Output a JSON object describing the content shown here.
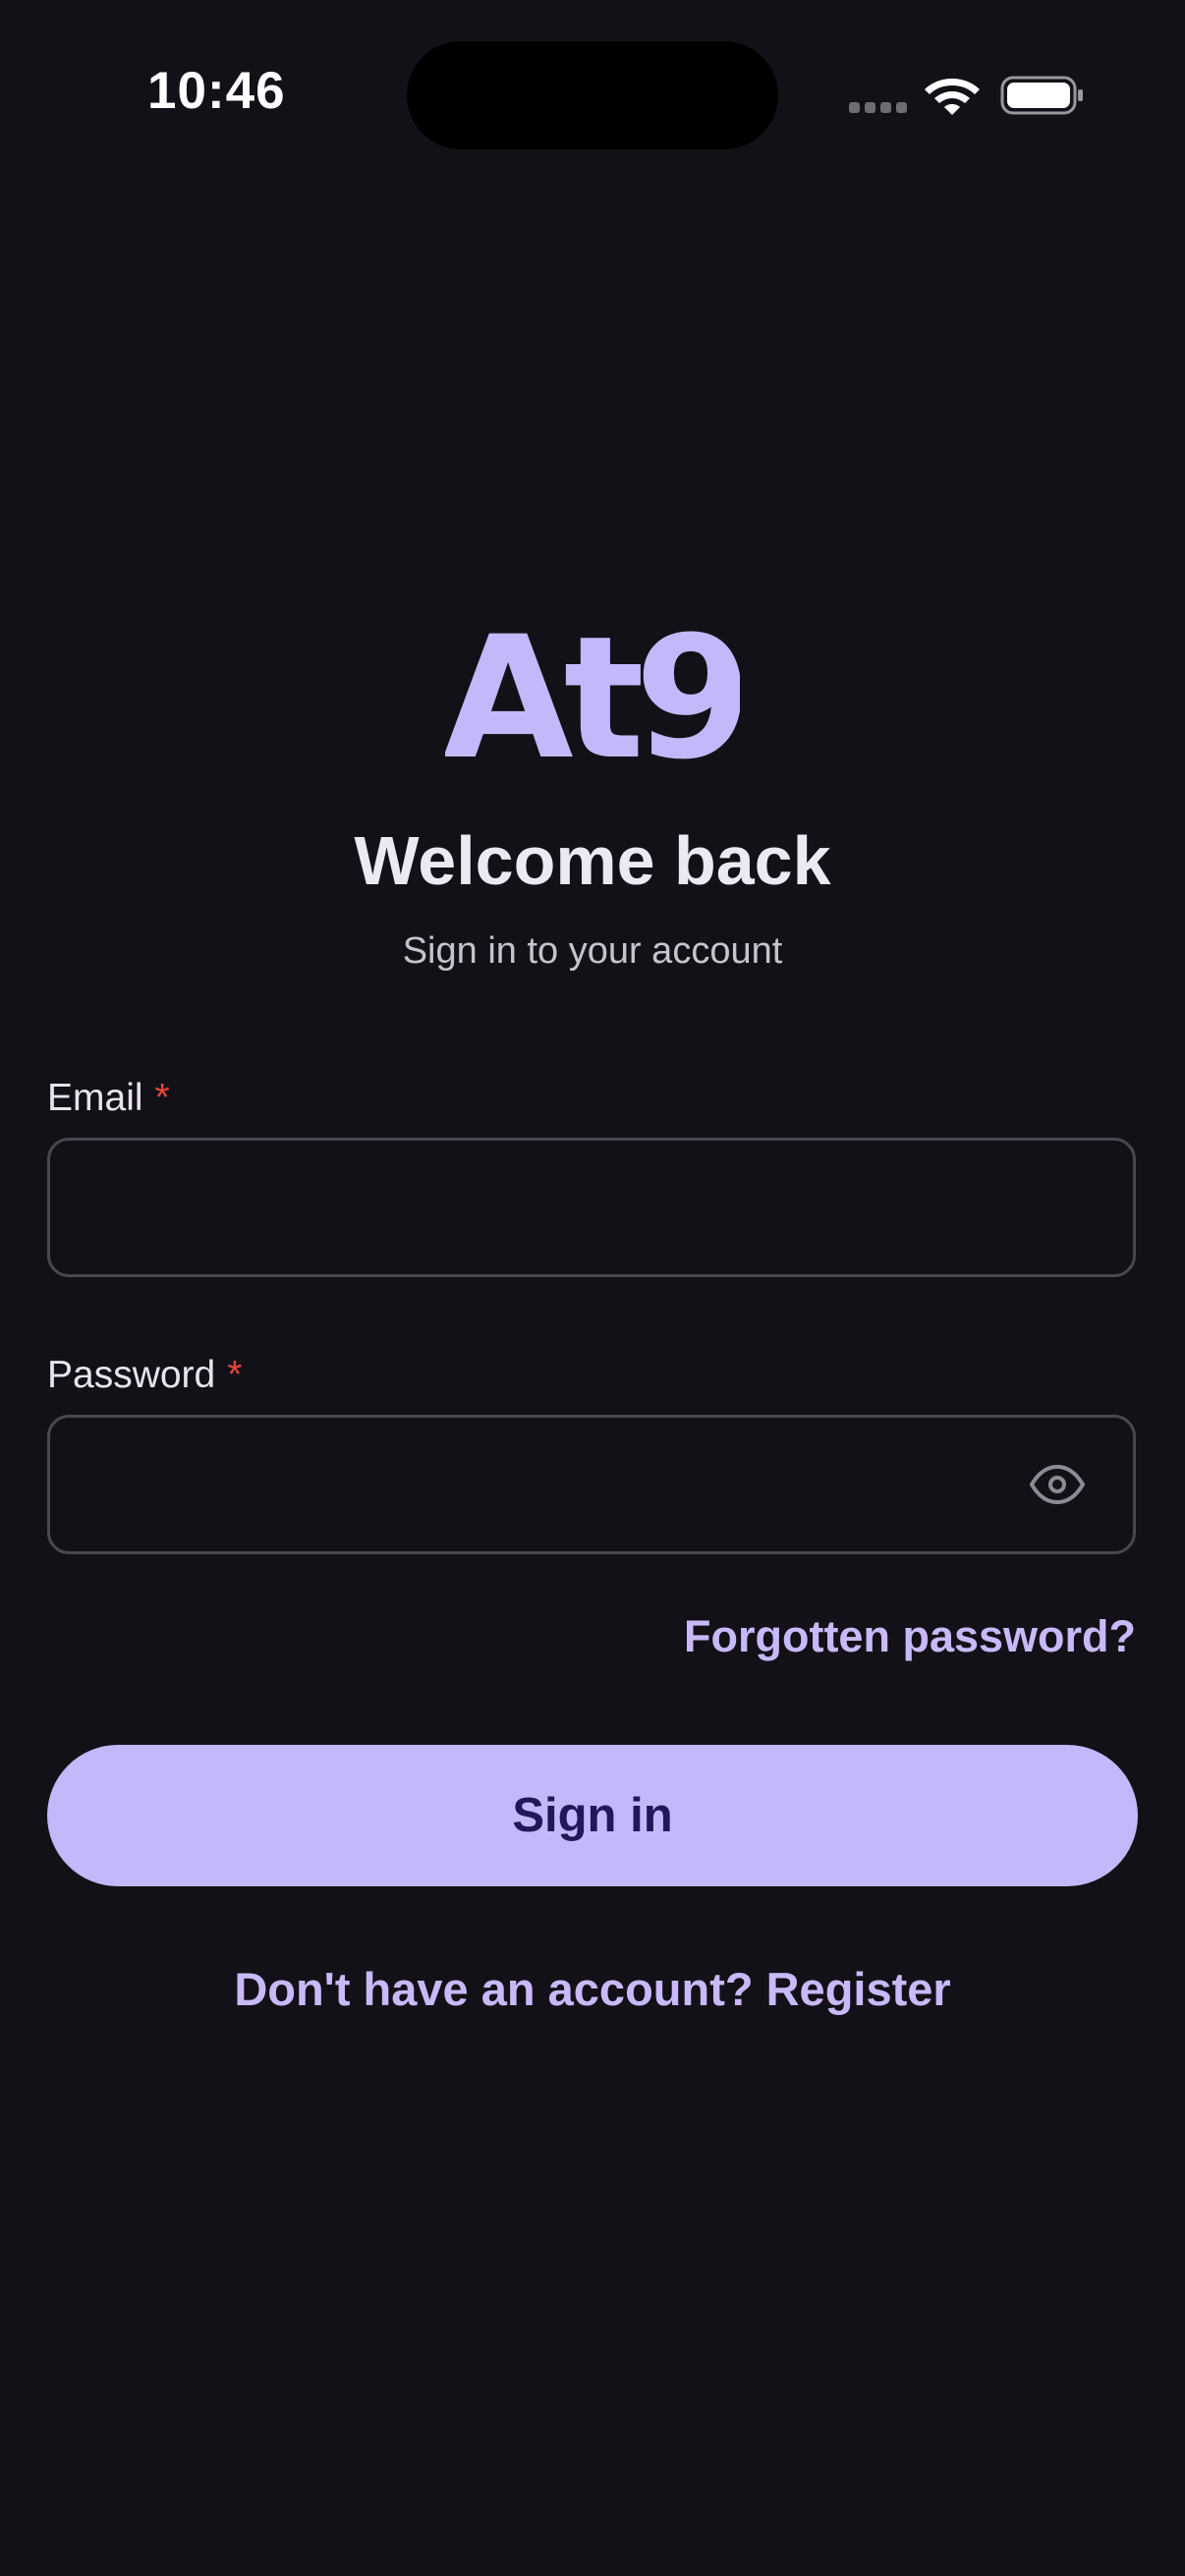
{
  "status_bar": {
    "time": "10:46"
  },
  "brand": {
    "logo_text": "At9",
    "accent_color": "#C4B8FA"
  },
  "header": {
    "title": "Welcome back",
    "subtitle": "Sign in to your account"
  },
  "form": {
    "email": {
      "label": "Email",
      "required_mark": "*",
      "value": ""
    },
    "password": {
      "label": "Password",
      "required_mark": "*",
      "value": "",
      "toggle_icon": "eye-icon"
    },
    "forgot_password_label": "Forgotten password?",
    "submit_label": "Sign in",
    "register_prompt": "Don't have an account? Register"
  }
}
